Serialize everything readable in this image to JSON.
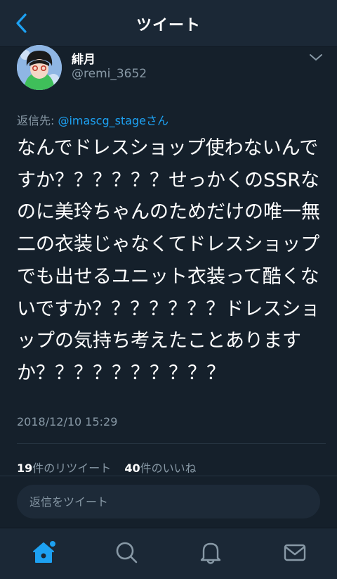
{
  "header": {
    "title": "ツイート"
  },
  "tweet": {
    "display_name": "緋月",
    "handle": "@remi_3652",
    "reply_label": "返信先: ",
    "reply_mention": "@imascg_stage",
    "reply_suffix": "さん",
    "text": "なんでドレスショップ使わないんですか？？？？？？せっかくのSSRなのに美玲ちゃんのためだけの唯一無二の衣装じゃなくてドレスショップでも出せるユニット衣装って酷くないですか？？？？？？？ドレスショップの気持ち考えたことありますか？？？？？？？？？？",
    "timestamp": "2018/12/10 15:29"
  },
  "stats": {
    "retweets_count": "19",
    "retweets_label": "件のリツイート",
    "likes_count": "40",
    "likes_label": "件のいいね"
  },
  "reply": {
    "placeholder": "返信をツイート"
  },
  "tabs": [
    "home-icon",
    "search-icon",
    "notifications-icon",
    "messages-icon"
  ],
  "colors": {
    "accent": "#1da1f2",
    "background": "#15202b",
    "secondary_text": "#8899a6"
  }
}
